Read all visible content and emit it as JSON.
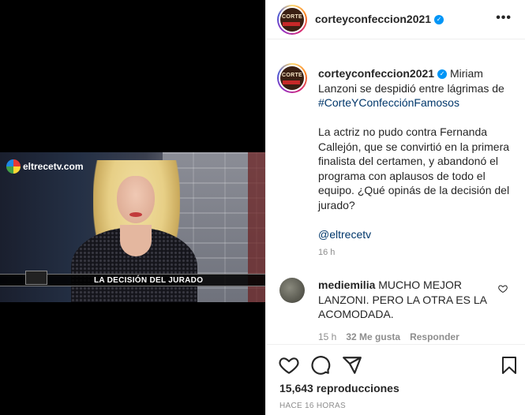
{
  "post": {
    "account": "corteyconfeccion2021",
    "avatar_text": "CORTE",
    "verified_glyph": "✓",
    "more_glyph": "•••",
    "video": {
      "channel_logo": "eltrecetv.com",
      "lower_third": "LA DECISIÓN DEL JURADO"
    },
    "caption": {
      "user": "corteyconfeccion2021",
      "line1": "Miriam Lanzoni se despidió entre lágrimas de ",
      "hashtag": "#CorteYConfecciónFamosos",
      "paragraph2": "La actriz no pudo contra Fernanda Callejón, que se convirtió en la primera finalista del certamen, y abandonó el programa con aplausos de todo el equipo. ¿Qué opinás de la decisión del jurado?",
      "mention": "@eltrecetv",
      "time": "16 h"
    },
    "comment": {
      "user": "mediemilia",
      "text": "MUCHO MEJOR LANZONI. PERO LA OTRA ES LA ACOMODADA.",
      "time": "15 h",
      "likes": "32 Me gusta",
      "reply": "Responder"
    },
    "views_count": "15,643",
    "views_label": "reproducciones",
    "posted_ago": "HACE 16 HORAS"
  },
  "colors": {
    "link": "#00376b",
    "verified": "#0095f6",
    "muted": "#8e8e8e"
  },
  "icons": [
    "heart-icon",
    "comment-icon",
    "share-icon",
    "bookmark-icon",
    "more-icon",
    "verified-icon"
  ]
}
